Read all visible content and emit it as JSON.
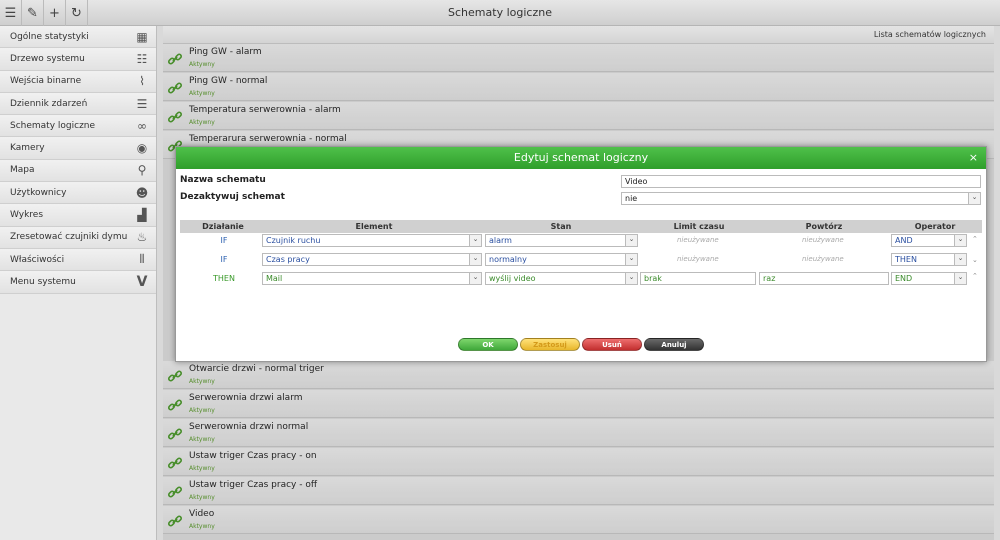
{
  "app": {
    "title": "Schematy logiczne"
  },
  "toolbar": {
    "icons": [
      "menu-icon",
      "wand-icon",
      "plus-icon",
      "refresh-icon"
    ]
  },
  "sidebar": {
    "items": [
      {
        "label": "Ogólne statystyki",
        "icon": "dashboard-grid-icon"
      },
      {
        "label": "Drzewo systemu",
        "icon": "tree-icon"
      },
      {
        "label": "Wejścia binarne",
        "icon": "binary-input-icon"
      },
      {
        "label": "Dziennik zdarzeń",
        "icon": "list-icon"
      },
      {
        "label": "Schematy logiczne",
        "icon": "link-icon"
      },
      {
        "label": "Kamery",
        "icon": "eye-icon"
      },
      {
        "label": "Mapa",
        "icon": "map-pin-icon"
      },
      {
        "label": "Użytkownicy",
        "icon": "users-icon"
      },
      {
        "label": "Wykres",
        "icon": "bar-chart-icon"
      },
      {
        "label": "Zresetować czujniki dymu",
        "icon": "flame-icon"
      },
      {
        "label": "Właściwości",
        "icon": "sliders-icon"
      },
      {
        "label": "Menu systemu",
        "icon": "v-logo-icon"
      }
    ]
  },
  "list": {
    "header": "Lista schematów logicznych",
    "rows_top": [
      {
        "name": "Ping GW - alarm",
        "status": "Aktywny"
      },
      {
        "name": "Ping GW - normal",
        "status": "Aktywny"
      },
      {
        "name": "Temperatura serwerownia - alarm",
        "status": "Aktywny"
      },
      {
        "name": "Temperarura serwerownia - normal",
        "status": ""
      }
    ],
    "rows_bottom": [
      {
        "name": "Otwarcie drzwi - normal triger",
        "status": "Aktywny"
      },
      {
        "name": "Serwerownia drzwi alarm",
        "status": "Aktywny"
      },
      {
        "name": "Serwerownia drzwi normal",
        "status": "Aktywny"
      },
      {
        "name": "Ustaw triger Czas pracy - on",
        "status": "Aktywny"
      },
      {
        "name": "Ustaw triger Czas pracy - off",
        "status": "Aktywny"
      },
      {
        "name": "Video",
        "status": "Aktywny"
      }
    ]
  },
  "modal": {
    "title": "Edytuj schemat logiczny",
    "close": "×",
    "name_label": "Nazwa schematu",
    "name_value": "Video",
    "deactivate_label": "Dezaktywuj schemat",
    "deactivate_value": "nie",
    "columns": [
      "Działanie",
      "Element",
      "Stan",
      "Limit czasu",
      "Powtórz",
      "Operator"
    ],
    "rows": [
      {
        "action": "IF",
        "element": "Czujnik ruchu",
        "state": "alarm",
        "limit": "nieużywane",
        "repeat": "nieużywane",
        "operator": "AND"
      },
      {
        "action": "IF",
        "element": "Czas pracy",
        "state": "normalny",
        "limit": "nieużywane",
        "repeat": "nieużywane",
        "operator": "THEN"
      },
      {
        "action": "THEN",
        "element": "Mail",
        "state": "wyślij video",
        "limit": "brak",
        "repeat": "raz",
        "operator": "END"
      }
    ],
    "buttons": {
      "ok": "OK",
      "apply": "Zastosuj",
      "delete": "Usuń",
      "cancel": "Anuluj"
    }
  }
}
